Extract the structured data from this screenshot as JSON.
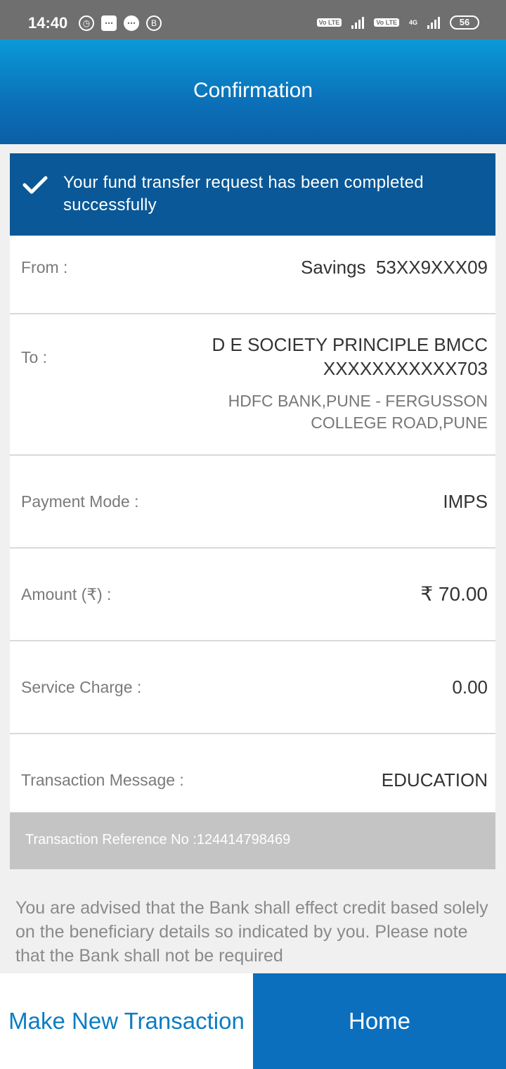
{
  "status_bar": {
    "time": "14:40",
    "network_type": "4G",
    "lte_badge": "Vo LTE",
    "battery": "56"
  },
  "header": {
    "title": "Confirmation"
  },
  "banner": {
    "message": "Your fund transfer request has been completed successfully"
  },
  "details": {
    "from_label": "From :",
    "from_value": "Savings  53XX9XXX09",
    "to_label": "To :",
    "to_name": "D E SOCIETY PRINCIPLE BMCC",
    "to_account": "XXXXXXXXXXX703",
    "to_bank_line1": "HDFC BANK,PUNE - FERGUSSON",
    "to_bank_line2": "COLLEGE ROAD,PUNE",
    "payment_mode_label": "Payment Mode :",
    "payment_mode_value": "IMPS",
    "amount_label": "Amount (₹) :",
    "amount_value": "₹ 70.00",
    "service_charge_label": "Service Charge :",
    "service_charge_value": "0.00",
    "message_label": "Transaction Message :",
    "message_value": "EDUCATION"
  },
  "reference": {
    "text": "Transaction Reference No :124414798469"
  },
  "disclaimer": "You are advised that the Bank shall effect credit based solely on the beneficiary details so indicated by you. Please note that the Bank shall not be required",
  "actions": {
    "new_transaction": "Make New Transaction",
    "home": "Home"
  }
}
